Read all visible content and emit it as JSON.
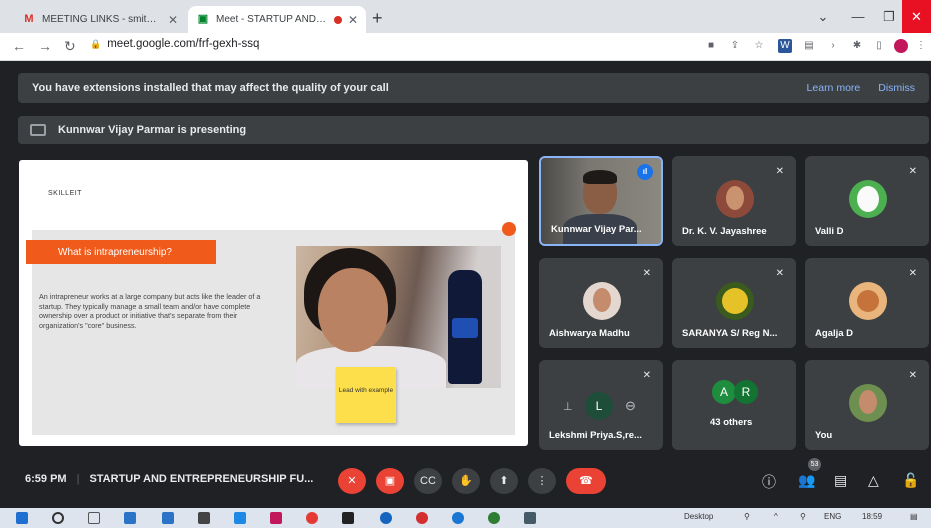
{
  "browser": {
    "tabs": [
      {
        "title": "MEETING LINKS - smitharcnair@...",
        "favicon": "gmail-icon",
        "color": "#d93025"
      },
      {
        "title": "Meet - STARTUP AND ENTR...",
        "favicon": "meet-icon",
        "color": "#00832d",
        "recording": true
      }
    ],
    "url": "meet.google.com/frf-gexh-ssq",
    "window_controls": [
      "minimize",
      "maximize",
      "close"
    ]
  },
  "banner": {
    "message": "You have extensions installed that may affect the quality of your call",
    "learn_more": "Learn more",
    "dismiss": "Dismiss"
  },
  "presenting": {
    "text": "Kunnwar Vijay Parmar is presenting"
  },
  "slide": {
    "brand": "SKILLEIT",
    "heading": "What is intrapreneurship?",
    "body": "An intrapreneur works at a large company but acts like the leader of a startup. They typically manage a small team and/or have complete ownership over a product or initiative that's separate from their organization's \"core\" business.",
    "note": "Lead with example",
    "accent": "#f05a1a"
  },
  "participants": [
    {
      "name": "Kunnwar Vijay Par...",
      "speaking": true
    },
    {
      "name": "Dr. K. V. Jayashree",
      "muted": true
    },
    {
      "name": "Valli D",
      "muted": true
    },
    {
      "name": "Aishwarya Madhu",
      "muted": true
    },
    {
      "name": "SARANYA S/ Reg N...",
      "muted": true
    },
    {
      "name": "Agalja D",
      "muted": true
    },
    {
      "name": "Lekshmi Priya.S,re...",
      "muted": true
    },
    {
      "name": "43 others",
      "initials": [
        "A",
        "R"
      ]
    },
    {
      "name": "You",
      "muted": true
    }
  ],
  "bottom": {
    "time": "6:59 PM",
    "meeting_title": "STARTUP AND ENTREPRENEURSHIP FU...",
    "people_count": "53"
  },
  "taskbar": {
    "desktop_label": "Desktop",
    "lang": "ENG",
    "clock": "18:59"
  }
}
